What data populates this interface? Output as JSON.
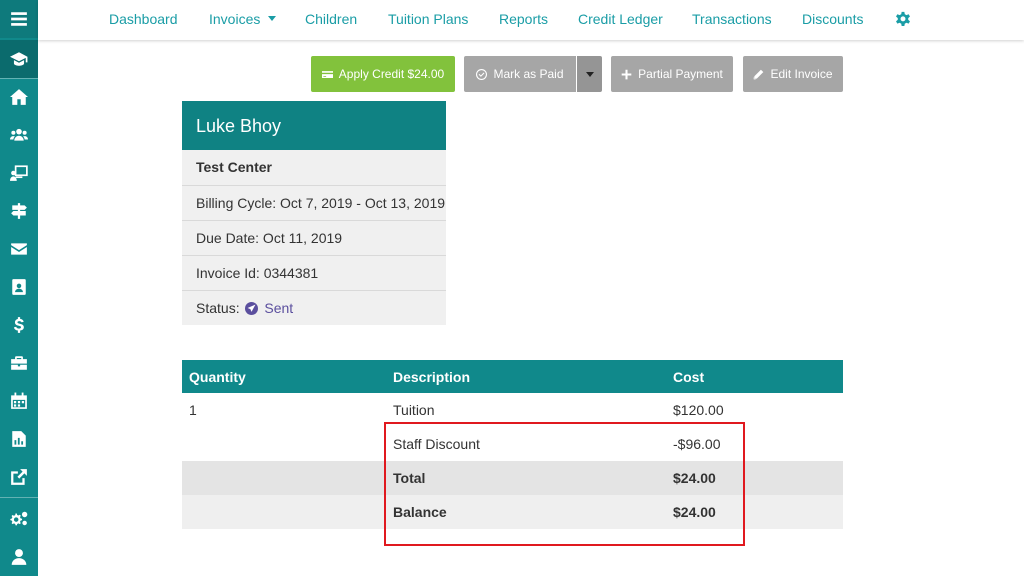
{
  "nav": {
    "links": [
      "Dashboard",
      "Invoices",
      "Children",
      "Tuition Plans",
      "Reports",
      "Credit Ledger",
      "Transactions",
      "Discounts"
    ],
    "settings_icon": "gear-icon"
  },
  "sidebar": {
    "icons": [
      "menu-icon",
      "graduation-cap-icon",
      "home-icon",
      "users-icon",
      "classroom-icon",
      "signpost-icon",
      "envelope-icon",
      "address-book-icon",
      "dollar-icon",
      "briefcase-icon",
      "calendar-icon",
      "report-icon",
      "external-link-icon",
      "cogs-icon",
      "user-icon"
    ]
  },
  "actions": {
    "apply_credit": "Apply Credit $24.00",
    "mark_paid": "Mark as Paid",
    "partial_payment": "Partial Payment",
    "edit_invoice": "Edit Invoice"
  },
  "invoice": {
    "name": "Luke Bhoy",
    "center": "Test Center",
    "billing_cycle": "Billing Cycle: Oct 7, 2019 - Oct 13, 2019",
    "due_date": "Due Date: Oct 11, 2019",
    "invoice_id": "Invoice Id: 0344381",
    "status_label": "Status:",
    "status_value": "Sent"
  },
  "table": {
    "headers": [
      "Quantity",
      "Description",
      "Cost"
    ],
    "rows": [
      {
        "quantity": "1",
        "description": "Tuition",
        "cost": "$120.00"
      },
      {
        "quantity": "",
        "description": "Staff Discount",
        "cost": "-$96.00"
      },
      {
        "quantity": "",
        "description": "Total",
        "cost": "$24.00"
      },
      {
        "quantity": "",
        "description": "Balance",
        "cost": "$24.00"
      }
    ]
  },
  "colors": {
    "teal": "#10898b",
    "nav_link": "#1a9da6",
    "green_button": "#82c23c",
    "grey_button": "#a6a6a6",
    "status": "#5b4f9e",
    "highlight": "#e0191f"
  }
}
